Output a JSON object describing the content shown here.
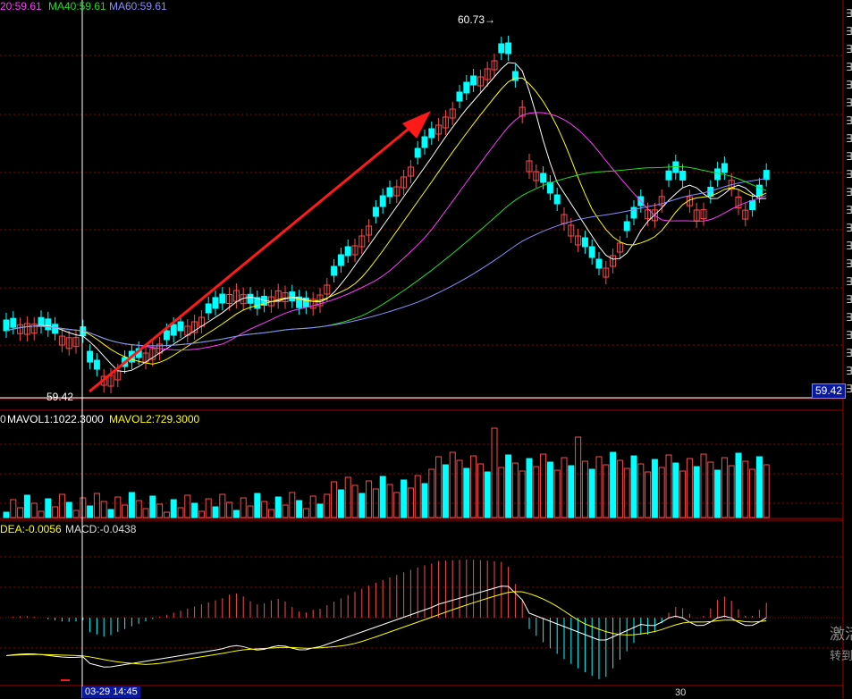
{
  "indicators": {
    "ma_top": [
      {
        "label": "20:59.61",
        "color": "#ff3cff"
      },
      {
        "label": "MA40:59.61",
        "color": "#22dd22"
      },
      {
        "label": "MA60:59.61",
        "color": "#8c8cff"
      }
    ],
    "vol": [
      {
        "label": "0",
        "color": "#dddddd"
      },
      {
        "label": "MAVOL1:1022.3000",
        "color": "#ffffff"
      },
      {
        "label": "MAVOL2:729.3000",
        "color": "#ffff00"
      }
    ],
    "macd": [
      {
        "label": "DEA:-0.0056",
        "color": "#ffff00"
      },
      {
        "label": "MACD:-0.0438",
        "color": "#dddddd"
      }
    ]
  },
  "price": {
    "high_label": "60.73",
    "low_label": "59.42",
    "current_box": "59.42"
  },
  "crosshair": {
    "date": "03-29 14:45"
  },
  "xaxis": {
    "tick": "30"
  },
  "watermark": {
    "line1": "激活",
    "line2": "转到"
  },
  "right_edge_chars": [
    "∃",
    "∃",
    "∃",
    "∃",
    "∃",
    "∃",
    "∃",
    "∃",
    "∃",
    "∃",
    "∃",
    "∃",
    "∃",
    "∃",
    "∃",
    "∃",
    "∃",
    "∃",
    "∃",
    "∃",
    "∃",
    "∃"
  ],
  "colors": {
    "up": "#ff4a4a",
    "down": "#00ffff",
    "grid": "#8b0000",
    "axis": "#a40000",
    "arrow": "#ff1a1a"
  }
}
